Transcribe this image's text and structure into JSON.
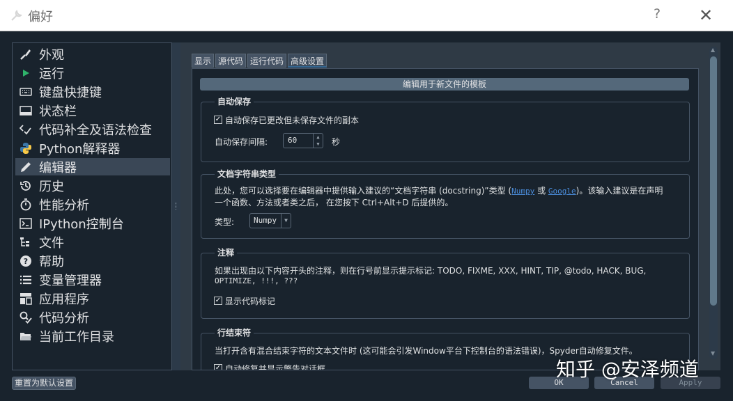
{
  "window": {
    "title": "偏好",
    "help_glyph": "?",
    "close_glyph": "✕"
  },
  "sidebar": {
    "items": [
      {
        "label": "外观",
        "icon": "brush-icon"
      },
      {
        "label": "运行",
        "icon": "play-icon"
      },
      {
        "label": "键盘快捷键",
        "icon": "keyboard-icon"
      },
      {
        "label": "状态栏",
        "icon": "statusbar-icon"
      },
      {
        "label": "代码补全及语法检查",
        "icon": "code-check-icon"
      },
      {
        "label": "Python解释器",
        "icon": "python-icon"
      },
      {
        "label": "编辑器",
        "icon": "pencil-icon",
        "active": true
      },
      {
        "label": "历史",
        "icon": "history-icon"
      },
      {
        "label": "性能分析",
        "icon": "stopwatch-icon"
      },
      {
        "label": "IPython控制台",
        "icon": "console-icon"
      },
      {
        "label": "文件",
        "icon": "file-tree-icon"
      },
      {
        "label": "帮助",
        "icon": "help-icon"
      },
      {
        "label": "变量管理器",
        "icon": "list-icon"
      },
      {
        "label": "应用程序",
        "icon": "apps-icon"
      },
      {
        "label": "代码分析",
        "icon": "code-analysis-icon"
      },
      {
        "label": "当前工作目录",
        "icon": "folder-icon"
      }
    ]
  },
  "tabs": [
    {
      "label": "显示"
    },
    {
      "label": "源代码"
    },
    {
      "label": "运行代码"
    },
    {
      "label": "高级设置",
      "active": true
    }
  ],
  "advanced": {
    "template_button": "编辑用于新文件的模板",
    "autosave": {
      "title": "自动保存",
      "checkbox_label": "自动保存已更改但未保存文件的副本",
      "checked": true,
      "interval_label": "自动保存间隔:",
      "interval_value": "60",
      "interval_unit": "秒"
    },
    "docstring": {
      "title": "文档字符串类型",
      "desc_part1": "此处，您可以选择要在编辑器中提供输入建议的“文档字符串 (docstring)”类型 (",
      "link_numpy": "Numpy",
      "desc_or": " 或 ",
      "link_google": "Google",
      "desc_part2": ")。该输入建议是在声明",
      "desc_line2": "一个函数、方法或者类之后， 在您按下 Ctrl+Alt+D 后提供的。",
      "type_label": "类型:",
      "type_value": "Numpy"
    },
    "annotations": {
      "title": "注释",
      "desc_line1": "如果出现由以下内容开头的注释，则在行号前显示提示标记: TODO, FIXME, XXX, HINT, TIP, @todo, HACK, BUG,",
      "desc_line2": "OPTIMIZE, !!!, ???",
      "checkbox_label": "显示代码标记",
      "checked": true
    },
    "eol": {
      "title": "行结束符",
      "desc": "当打开含有混合结束字符的文本文件时 (这可能会引发Window平台下控制台的语法错误)，Spyder自动修复文件。",
      "checkbox_label": "自动修复并显示警告对话框",
      "checked": true
    }
  },
  "buttons": {
    "reset": "重置为默认设置",
    "ok": "OK",
    "cancel": "Cancel",
    "apply": "Apply"
  },
  "watermark": "知乎 @安泽频道",
  "colors": {
    "background": "#19232d",
    "selection": "#3a4756",
    "link": "#4a8bd8"
  }
}
